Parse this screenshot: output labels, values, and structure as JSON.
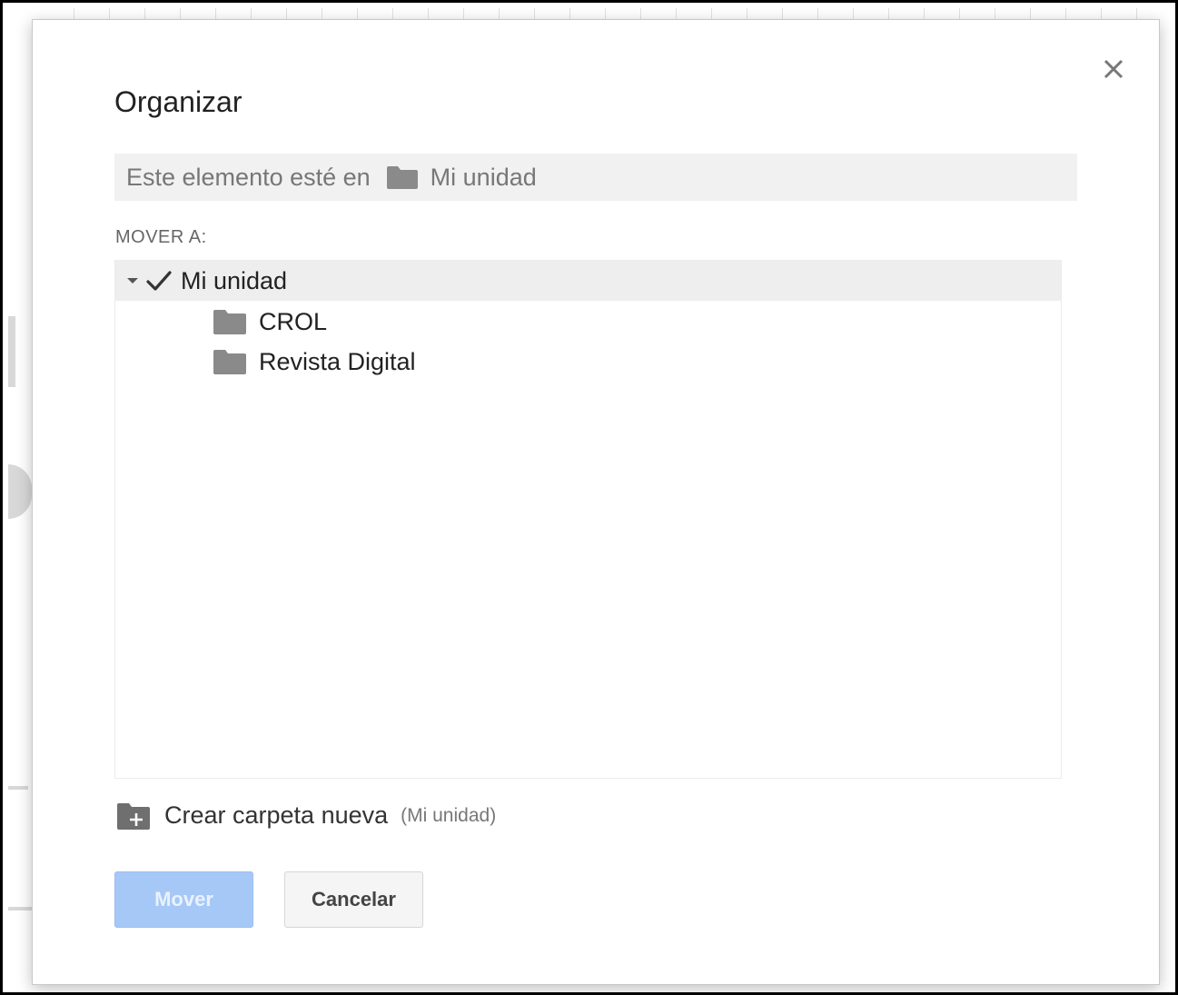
{
  "dialog": {
    "title": "Organizar",
    "close_icon": "close-icon",
    "location": {
      "prefix": "Este elemento esté en",
      "folder_icon": "folder-icon",
      "folder_name": "Mi unidad"
    },
    "move_to_label": "MOVER A:",
    "tree": {
      "root": {
        "label": "Mi unidad",
        "expanded": true,
        "selected": true
      },
      "children": [
        {
          "label": "CROL",
          "icon": "folder-icon"
        },
        {
          "label": "Revista Digital",
          "icon": "folder-icon"
        }
      ]
    },
    "create_folder": {
      "label": "Crear carpeta nueva",
      "hint": "(Mi unidad)",
      "icon": "new-folder-icon"
    },
    "buttons": {
      "move": "Mover",
      "cancel": "Cancelar"
    }
  },
  "colors": {
    "move_button_disabled": "#a6c8f6",
    "selected_row": "#eeeeee",
    "folder_icon": "#8a8a8a"
  }
}
